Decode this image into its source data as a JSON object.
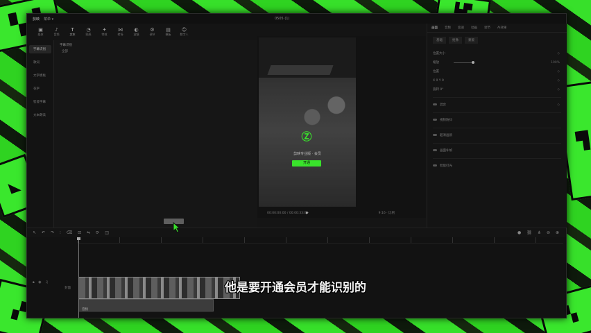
{
  "colors": {
    "accent": "#39e22b",
    "window_bg": "#151515"
  },
  "titlebar": {
    "logo": "剪映",
    "menu": "菜单 ▾",
    "project": "0505 (1)"
  },
  "toolbar": [
    {
      "label": "媒体",
      "icon": "media-icon"
    },
    {
      "label": "音频",
      "icon": "audio-icon"
    },
    {
      "label": "文本",
      "icon": "text-icon"
    },
    {
      "label": "贴纸",
      "icon": "sticker-icon"
    },
    {
      "label": "特效",
      "icon": "effect-icon"
    },
    {
      "label": "转场",
      "icon": "transition-icon"
    },
    {
      "label": "滤镜",
      "icon": "filter-icon"
    },
    {
      "label": "调节",
      "icon": "adjust-icon"
    },
    {
      "label": "模板",
      "icon": "template-icon"
    },
    {
      "label": "数字人",
      "icon": "avatar-icon"
    }
  ],
  "leftnav": [
    "字幕识别",
    "歌词",
    "文字模板",
    "花字",
    "智能字幕",
    "文本朗读"
  ],
  "media": {
    "header": "字幕识别",
    "filter": "全部"
  },
  "preview": {
    "vip_message": "剪映专业版 · 会员",
    "vip_button": "开通",
    "timecode": "00:00:00:00 / 00:00:33:08",
    "ratio": "9:16 · 比例",
    "play_icon": "▶"
  },
  "props": {
    "tabs": [
      "画面",
      "音频",
      "变速",
      "动画",
      "调节",
      "AI效果"
    ],
    "subtabs": [
      "基础",
      "抠像",
      "蒙版"
    ],
    "rows": [
      {
        "label": "位置大小",
        "right": "◇"
      },
      {
        "label": "缩放",
        "right": "100%"
      },
      {
        "label": "位置",
        "right": "◇"
      },
      {
        "label": "X 0  Y 0",
        "right": "◇"
      },
      {
        "label": "旋转 0°",
        "right": "◇"
      },
      {
        "label": "混合",
        "right": "◇"
      },
      {
        "label": "视频防抖",
        "right": ""
      },
      {
        "label": "超清画质",
        "right": ""
      },
      {
        "label": "画面补帧",
        "right": ""
      },
      {
        "label": "智能打光",
        "right": ""
      }
    ]
  },
  "timeline": {
    "track_label": "封面",
    "clip2_label": "音频",
    "subtitle": "他是要开通会员才能识别的"
  }
}
